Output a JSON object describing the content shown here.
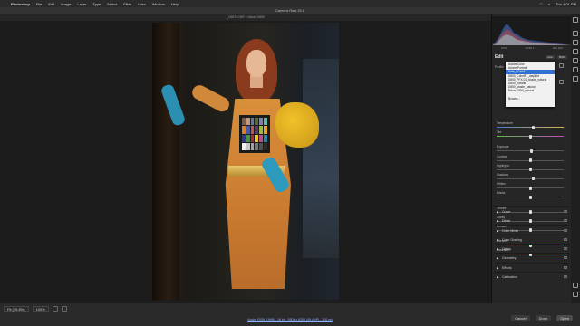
{
  "menubar": {
    "app": "Photoshop",
    "items": [
      "File",
      "Edit",
      "Image",
      "Layer",
      "Type",
      "Select",
      "Filter",
      "View",
      "Window",
      "Help"
    ],
    "right_time": "Thu 4:01 PM"
  },
  "window_title": "Camera Raw 15.5",
  "image_title": "_D6978.NEF  •  Nikon D850",
  "histogram": {
    "f_stop": "f/5.6",
    "exposure": "1/160 s",
    "iso": "ISO 100",
    "focal": "85 mm"
  },
  "edit_panel": {
    "title": "Edit",
    "tab_auto": "Auto",
    "tab_bw": "B&W",
    "profile_label": "Profile"
  },
  "profile_dropdown": {
    "options": [
      "Adobe Color",
      "Adobe Portrait",
      "Kate_dCam1",
      "D850_ColorRT_daylight",
      "D850_PFX-01_shade_natural",
      "D850_natural",
      "D850_shade_natural",
      "Nikon D850_natural",
      "",
      "Browse..."
    ],
    "selected_index": 2
  },
  "sliders": [
    {
      "label": "Temperature",
      "value": 0.55,
      "style": "temp"
    },
    {
      "label": "Tint",
      "value": 0.5,
      "style": "tint"
    },
    {
      "label": "",
      "value": null,
      "style": "gap"
    },
    {
      "label": "Exposure",
      "value": 0.52,
      "style": ""
    },
    {
      "label": "Contrast",
      "value": 0.5,
      "style": ""
    },
    {
      "label": "Highlights",
      "value": 0.5,
      "style": ""
    },
    {
      "label": "Shadows",
      "value": 0.55,
      "style": ""
    },
    {
      "label": "Whites",
      "value": 0.5,
      "style": ""
    },
    {
      "label": "Blacks",
      "value": 0.5,
      "style": ""
    },
    {
      "label": "",
      "value": null,
      "style": "gap"
    },
    {
      "label": "Texture",
      "value": 0.5,
      "style": ""
    },
    {
      "label": "Clarity",
      "value": 0.5,
      "style": ""
    },
    {
      "label": "Dehaze",
      "value": 0.5,
      "style": ""
    },
    {
      "label": "",
      "value": null,
      "style": "gap"
    },
    {
      "label": "Vibrance",
      "value": 0.5,
      "style": "sat"
    },
    {
      "label": "Saturation",
      "value": 0.5,
      "style": "sat"
    }
  ],
  "sections": [
    "Curve",
    "Detail",
    "Color Mixer",
    "Color Grading",
    "Optics",
    "Geometry",
    "Effects",
    "Calibration"
  ],
  "bottombar": {
    "fit_label": "Fit (39.8%)",
    "zoom_label": "100%",
    "file_info": "Adobe RGB (1998) - 16 bit - 5504 x 8256 (45.4MP) - 300 ppi",
    "cancel": "Cancel",
    "done": "Done",
    "open": "Open"
  },
  "filmstrip": {
    "count": 5,
    "active_index": 2
  },
  "colors": {
    "dropdown_selected": "#2f6fd6",
    "dress": "#d98f3a",
    "gloves": "#2a8fb0",
    "bow": "#f1c22a"
  }
}
